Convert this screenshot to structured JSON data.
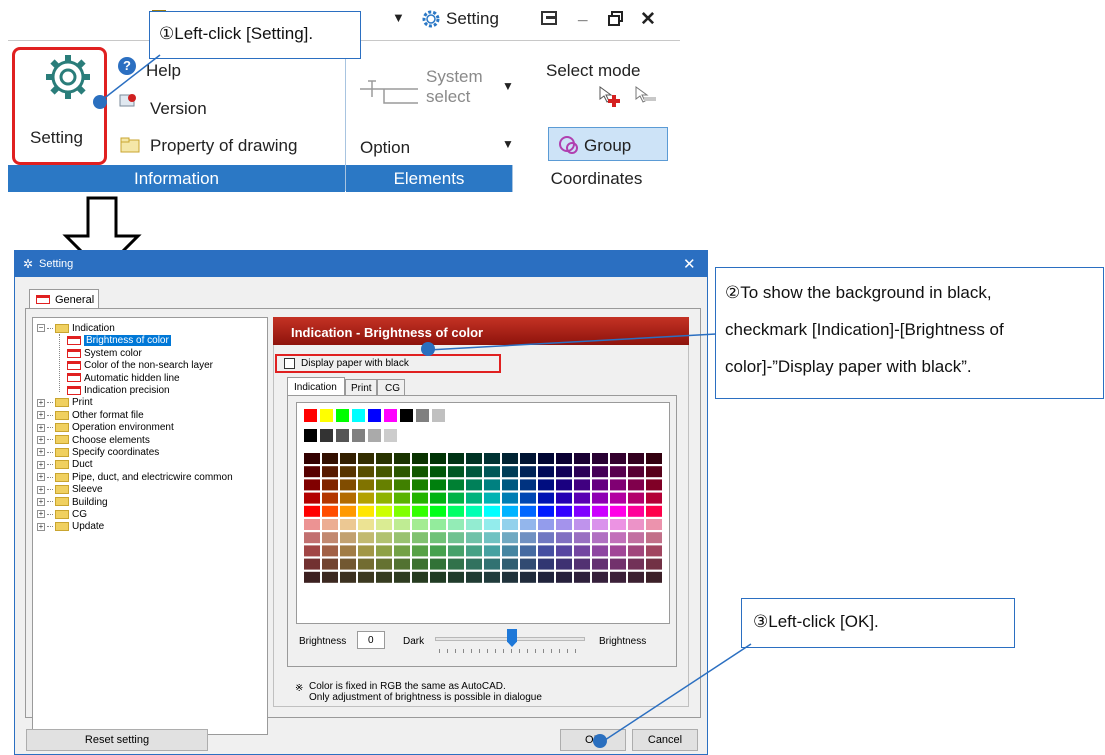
{
  "ribbon": {
    "quick_access": [
      "Setting"
    ],
    "information": {
      "setting_label": "Setting",
      "help_label": "Help",
      "version_label": "Version",
      "property_label": "Property of drawing",
      "group_label": "Information"
    },
    "elements": {
      "system_select_line1": "System",
      "system_select_line2": "select",
      "option_label": "Option",
      "group_label": "Elements"
    },
    "coordinates": {
      "select_mode_label": "Select mode",
      "group_button_label": "Group",
      "group_label": "Coordinates"
    }
  },
  "callouts": {
    "step1": "①Left-click [Setting].",
    "step2_l1": "②To show the background in black,",
    "step2_l2": "checkmark [Indication]-[Brightness of",
    "step2_l3": "color]-”Display paper with black”.",
    "step3": "③Left-click [OK]."
  },
  "dialog": {
    "title": "Setting",
    "tab_general": "General",
    "tree": [
      {
        "label": "Indication",
        "type": "folder",
        "level": 0,
        "expander": "−"
      },
      {
        "label": "Brightness of color",
        "type": "page",
        "level": 1,
        "selected": true
      },
      {
        "label": "System color",
        "type": "page",
        "level": 1
      },
      {
        "label": "Color of the non-search layer",
        "type": "page",
        "level": 1
      },
      {
        "label": "Automatic hidden line",
        "type": "page",
        "level": 1
      },
      {
        "label": "Indication precision",
        "type": "page",
        "level": 1
      },
      {
        "label": "Print",
        "type": "folder",
        "level": 0,
        "expander": "+"
      },
      {
        "label": "Other format file",
        "type": "folder",
        "level": 0,
        "expander": "+"
      },
      {
        "label": "Operation environment",
        "type": "folder",
        "level": 0,
        "expander": "+"
      },
      {
        "label": "Choose elements",
        "type": "folder",
        "level": 0,
        "expander": "+"
      },
      {
        "label": "Specify coordinates",
        "type": "folder",
        "level": 0,
        "expander": "+"
      },
      {
        "label": "Duct",
        "type": "folder",
        "level": 0,
        "expander": "+"
      },
      {
        "label": "Pipe, duct, and electricwire common",
        "type": "folder",
        "level": 0,
        "expander": "+"
      },
      {
        "label": "Sleeve",
        "type": "folder",
        "level": 0,
        "expander": "+"
      },
      {
        "label": "Building",
        "type": "folder",
        "level": 0,
        "expander": "+"
      },
      {
        "label": "CG",
        "type": "folder",
        "level": 0,
        "expander": "+"
      },
      {
        "label": "Update",
        "type": "folder",
        "level": 0,
        "expander": "+"
      }
    ],
    "panel_header": "Indication - Brightness of color",
    "checkbox_label": "Display paper with black",
    "checkbox_checked": false,
    "subtabs": [
      "Indication",
      "Print",
      "CG"
    ],
    "active_subtab": "Indication",
    "brightness_label": "Brightness",
    "brightness_value": "0",
    "dark_label": "Dark",
    "brightness_end_label": "Brightness",
    "note_mark": "※",
    "note_line1": "Color is fixed in RGB the same as AutoCAD.",
    "note_line2": "Only adjustment of brightness is possible in dialogue",
    "reset_button": "Reset setting",
    "ok_button": "OK",
    "cancel_button": "Cancel"
  },
  "palette": {
    "basic_colors": [
      "#ff0000",
      "#ffff00",
      "#00ff00",
      "#00ffff",
      "#0000ff",
      "#ff00ff",
      "#000000",
      "#808080",
      "#c0c0c0"
    ],
    "gray_colors": [
      "#000000",
      "#333333",
      "#555555",
      "#808080",
      "#aaaaaa",
      "#cccccc"
    ],
    "hue_columns": 20,
    "shade_rows": 10
  },
  "colors": {
    "ribbon_accent": "#2b78c5",
    "dialog_title": "#2b6fc1",
    "panel_header_red": "#b01a12",
    "highlight_red": "#e02020",
    "callout_dot": "#2a6fbf"
  }
}
